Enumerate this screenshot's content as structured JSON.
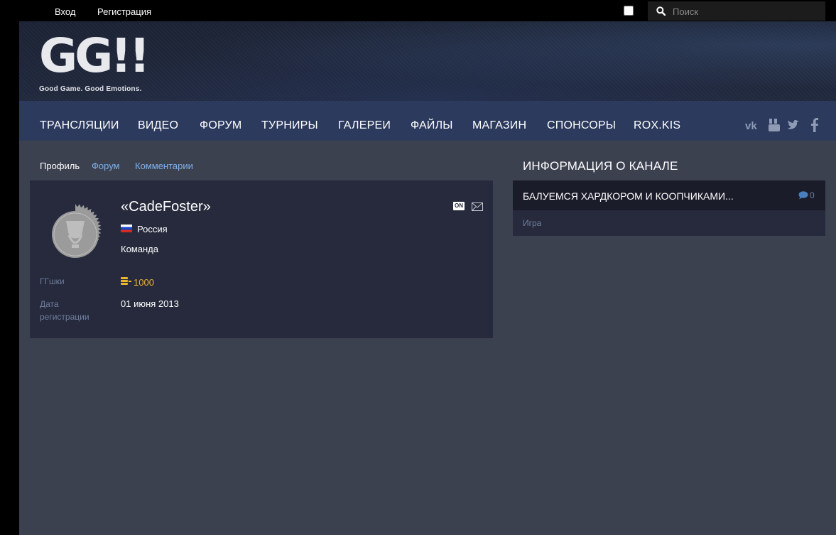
{
  "topbar": {
    "login_label": "Вход",
    "register_label": "Регистрация",
    "search_placeholder": "Поиск"
  },
  "header": {
    "logo_text": "GG!!",
    "logo_tagline": "Good Game. Good Emotions."
  },
  "nav": {
    "items": [
      "ТРАНСЛЯЦИИ",
      "ВИДЕО",
      "ФОРУМ",
      "ТУРНИРЫ",
      "ГАЛЕРЕИ",
      "ФАЙЛЫ",
      "МАГАЗИН",
      "СПОНСОРЫ",
      "ROX.KIS"
    ],
    "social_icons": [
      "vk-icon",
      "youtube-icon",
      "twitter-icon",
      "facebook-icon"
    ]
  },
  "profile_tabs": {
    "profile": "Профиль",
    "forum": "Форум",
    "comments": "Комментарии"
  },
  "profile": {
    "username": "«CadeFoster»",
    "online_badge": "ON",
    "country": "Россия",
    "team_label": "Команда",
    "gg_label": "ГГшки",
    "gg_value": "1000",
    "reg_label": "Дата регистрации",
    "reg_date": "01 июня 2013"
  },
  "channel": {
    "title": "ИНФОРМАЦИЯ О КАНАЛЕ",
    "stream_title": "БАЛУЕМСЯ ХАРДКОРОМ И КООПЧИКАМИ...",
    "comment_count": "0",
    "game_label": "Игра"
  },
  "colors": {
    "page_bg": "#3c4150",
    "card_bg": "#262a3c",
    "nav_bg": "#2c3a5e",
    "link": "#7fb0e9",
    "muted": "#6f7f9f",
    "gold": "#e9b52e"
  }
}
